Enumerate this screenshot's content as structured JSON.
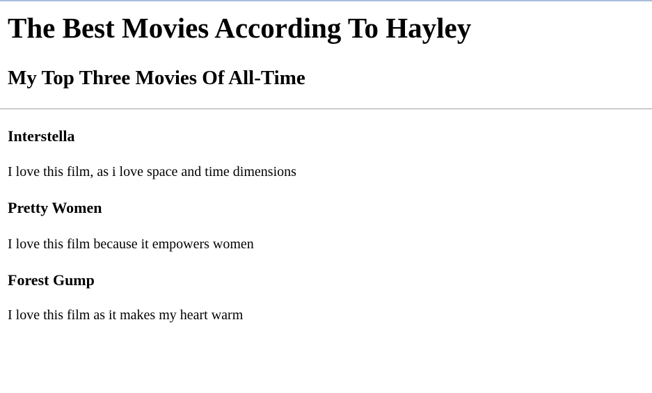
{
  "page": {
    "title": "The Best Movies According To Hayley",
    "subtitle": "My Top Three Movies Of All-Time"
  },
  "movies": [
    {
      "title": "Interstella",
      "description": "I love this film, as i love space and time dimensions"
    },
    {
      "title": "Pretty Women",
      "description": "I love this film because it empowers women"
    },
    {
      "title": "Forest Gump",
      "description": "I love this film as it makes my heart warm"
    }
  ]
}
